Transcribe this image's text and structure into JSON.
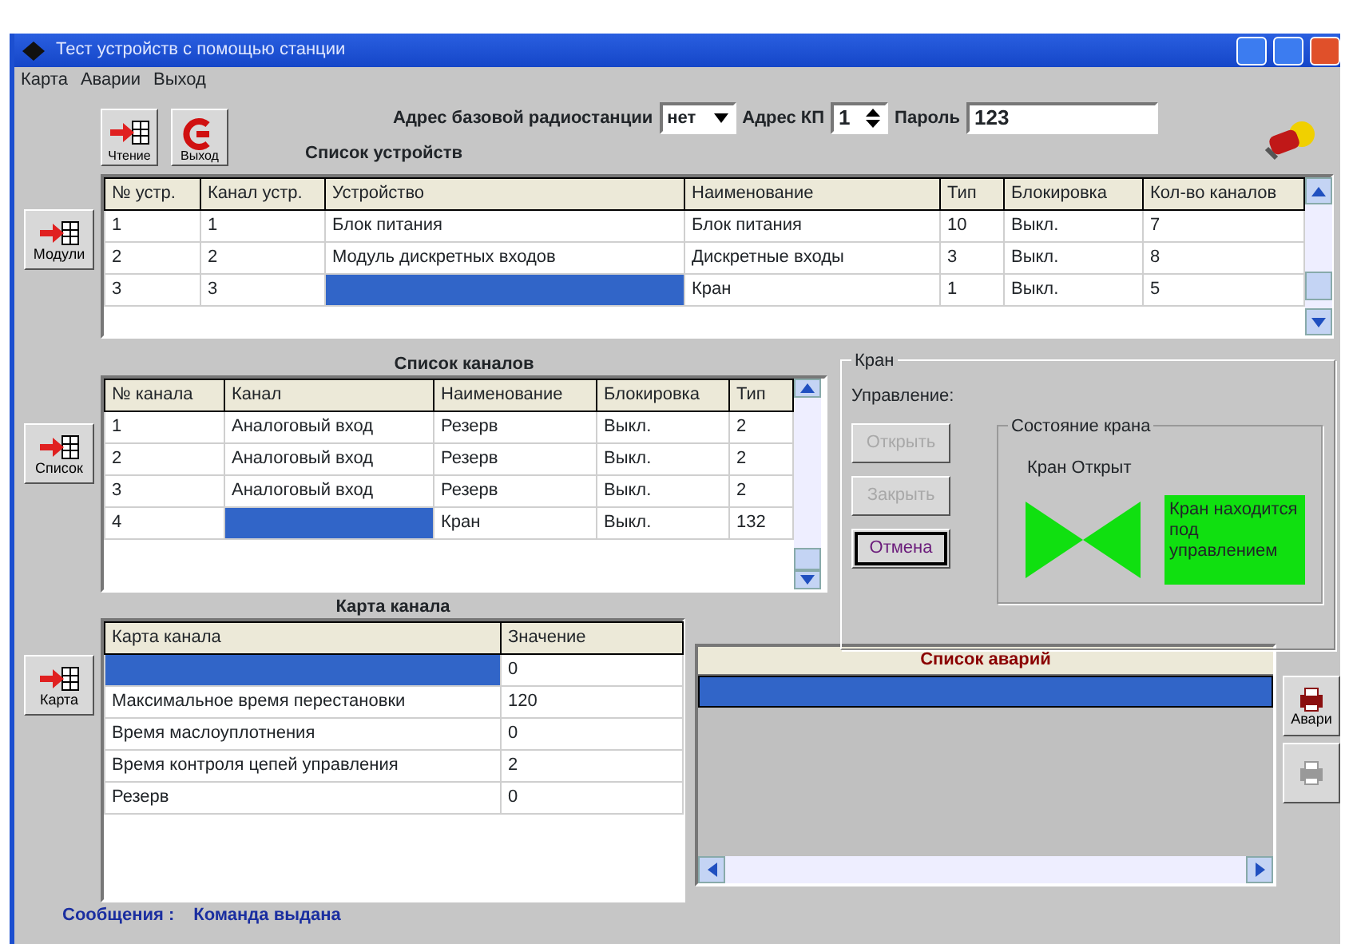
{
  "window": {
    "title": "Тест устройств с помощью станции"
  },
  "menu": [
    "Карта",
    "Аварии",
    "Выход"
  ],
  "toolbar": [
    {
      "label": "Чтение",
      "kind": "read"
    },
    {
      "label": "Выход",
      "kind": "exit"
    }
  ],
  "address": {
    "base_station_label": "Адрес базовой радиостанции",
    "base_station_value": "нет",
    "kp_label": "Адрес КП",
    "kp_value": "1",
    "password_label": "Пароль",
    "password_value": "123"
  },
  "side_buttons": [
    {
      "label": "Модули"
    },
    {
      "label": "Список"
    },
    {
      "label": "Карта"
    }
  ],
  "devices": {
    "title": "Список устройств",
    "columns": [
      "№ устр.",
      "Канал устр.",
      "Устройство",
      "Наименование",
      "Тип",
      "Блокировка",
      "Кол-во каналов"
    ],
    "rows": [
      {
        "cells": [
          {
            "text": "1",
            "selected": false
          },
          {
            "text": "1",
            "selected": false
          },
          {
            "text": "Блок питания",
            "selected": false
          },
          {
            "text": "Блок питания",
            "selected": false
          },
          {
            "text": "10",
            "selected": false
          },
          {
            "text": "Выкл.",
            "selected": false
          },
          {
            "text": "7",
            "selected": false
          }
        ]
      },
      {
        "cells": [
          {
            "text": "2",
            "selected": false
          },
          {
            "text": "2",
            "selected": false
          },
          {
            "text": "Модуль дискретных входов",
            "selected": false
          },
          {
            "text": "Дискретные входы",
            "selected": false
          },
          {
            "text": "3",
            "selected": false
          },
          {
            "text": "Выкл.",
            "selected": false
          },
          {
            "text": "8",
            "selected": false
          }
        ]
      },
      {
        "cells": [
          {
            "text": "3",
            "selected": false
          },
          {
            "text": "3",
            "selected": false
          },
          {
            "selected": true
          },
          {
            "text": "Кран",
            "selected": false
          },
          {
            "text": "1",
            "selected": false
          },
          {
            "text": "Выкл.",
            "selected": false
          },
          {
            "text": "5",
            "selected": false
          }
        ]
      }
    ]
  },
  "channels": {
    "title": "Список каналов",
    "columns": [
      "№ канала",
      "Канал",
      "Наименование",
      "Блокировка",
      "Тип"
    ],
    "rows": [
      {
        "cells": [
          {
            "text": "1",
            "selected": false
          },
          {
            "text": "Аналоговый вход",
            "selected": false
          },
          {
            "text": "Резерв",
            "selected": false
          },
          {
            "text": "Выкл.",
            "selected": false
          },
          {
            "text": "2",
            "selected": false
          }
        ]
      },
      {
        "cells": [
          {
            "text": "2",
            "selected": false
          },
          {
            "text": "Аналоговый вход",
            "selected": false
          },
          {
            "text": "Резерв",
            "selected": false
          },
          {
            "text": "Выкл.",
            "selected": false
          },
          {
            "text": "2",
            "selected": false
          }
        ]
      },
      {
        "cells": [
          {
            "text": "3",
            "selected": false
          },
          {
            "text": "Аналоговый вход",
            "selected": false
          },
          {
            "text": "Резерв",
            "selected": false
          },
          {
            "text": "Выкл.",
            "selected": false
          },
          {
            "text": "2",
            "selected": false
          }
        ]
      },
      {
        "cells": [
          {
            "text": "4",
            "selected": false
          },
          {
            "selected": true
          },
          {
            "text": "Кран",
            "selected": false
          },
          {
            "text": "Выкл.",
            "selected": false
          },
          {
            "text": "132",
            "selected": false
          }
        ]
      }
    ]
  },
  "crane": {
    "title": "Кран",
    "control_label": "Управление:",
    "buttons": [
      {
        "label": "Открыть",
        "disabled": true,
        "focused": false
      },
      {
        "label": "Закрыть",
        "disabled": true,
        "focused": false
      },
      {
        "label": "Отмена",
        "disabled": false,
        "focused": true
      }
    ],
    "state": {
      "title": "Состояние крана",
      "caption": "Кран Открыт",
      "open": true,
      "message": "Кран находится под управлением"
    }
  },
  "channel_map": {
    "title": "Карта канала",
    "columns": [
      "Карта канала",
      "Значение"
    ],
    "rows": [
      {
        "cells": [
          {
            "selected": true
          },
          {
            "text": "0",
            "selected": false
          }
        ]
      },
      {
        "cells": [
          {
            "text": "Максимальное время перестановки",
            "selected": false
          },
          {
            "text": "120",
            "selected": false
          }
        ]
      },
      {
        "cells": [
          {
            "text": "Время маслоуплотнения",
            "selected": false
          },
          {
            "text": "0",
            "selected": false
          }
        ]
      },
      {
        "cells": [
          {
            "text": "Время контроля цепей управления",
            "selected": false
          },
          {
            "text": "2",
            "selected": false
          }
        ]
      },
      {
        "cells": [
          {
            "text": "Резерв",
            "selected": false
          },
          {
            "text": "0",
            "selected": false
          }
        ]
      }
    ]
  },
  "alarms": {
    "title": "Список аварий",
    "rows": [
      {
        "selected": true
      }
    ]
  },
  "right_buttons": [
    {
      "label": "Авари",
      "disabled": false
    },
    {
      "disabled": true
    }
  ],
  "status": {
    "label": "Сообщения :",
    "text": "Команда выдана"
  }
}
